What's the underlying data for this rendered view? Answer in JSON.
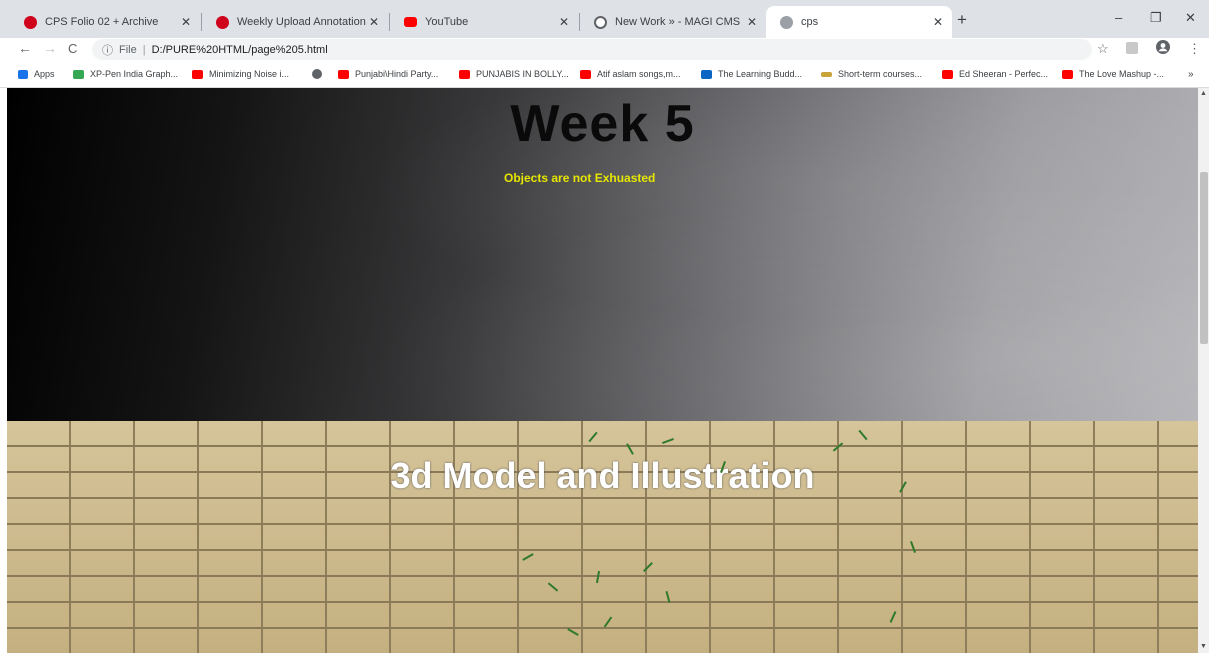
{
  "tabs": [
    {
      "title": "CPS Folio 02 + Archive",
      "favicon_color": "#d0021b"
    },
    {
      "title": "Weekly Upload Annotation Guid",
      "favicon_color": "#d0021b"
    },
    {
      "title": "YouTube",
      "favicon_color": "#ff0000"
    },
    {
      "title": "New Work » - MAGI CMS",
      "favicon_color": "#5f6368"
    },
    {
      "title": "cps",
      "favicon_color": "#5f6368"
    }
  ],
  "window": {
    "minimize": "–",
    "restore": "❐",
    "close": "✕",
    "new_tab": "+"
  },
  "toolbar": {
    "back": "←",
    "forward": "→",
    "reload": "C",
    "scheme": "File",
    "url": "D:/PURE%20HTML/page%205.html",
    "star": "☆",
    "menu": "⋮"
  },
  "bookmarks": [
    {
      "label": "Apps",
      "icon_color": "#1a73e8"
    },
    {
      "label": "XP-Pen India Graph...",
      "icon_color": "#34a853"
    },
    {
      "label": "Minimizing Noise i...",
      "icon_color": "#ff0000"
    },
    {
      "label": "",
      "icon_color": "#5f6368"
    },
    {
      "label": "Punjabi\\Hindi Party...",
      "icon_color": "#ff0000"
    },
    {
      "label": "PUNJABIS IN BOLLY...",
      "icon_color": "#ff0000"
    },
    {
      "label": "Atif aslam songs,m...",
      "icon_color": "#ff0000"
    },
    {
      "label": "The Learning Budd...",
      "icon_color": "#0a66c2"
    },
    {
      "label": "Short-term courses...",
      "icon_color": "#c8a33a"
    },
    {
      "label": "Ed Sheeran - Perfec...",
      "icon_color": "#ff0000"
    },
    {
      "label": "The Love Mashup -...",
      "icon_color": "#ff0000"
    }
  ],
  "bookmarks_more": "»",
  "page": {
    "title": "Week 5",
    "subtitle": "Objects are not Exhuasted",
    "section_title": "3d Model and Illustration"
  },
  "colors": {
    "subtitle": "#e6e600"
  }
}
